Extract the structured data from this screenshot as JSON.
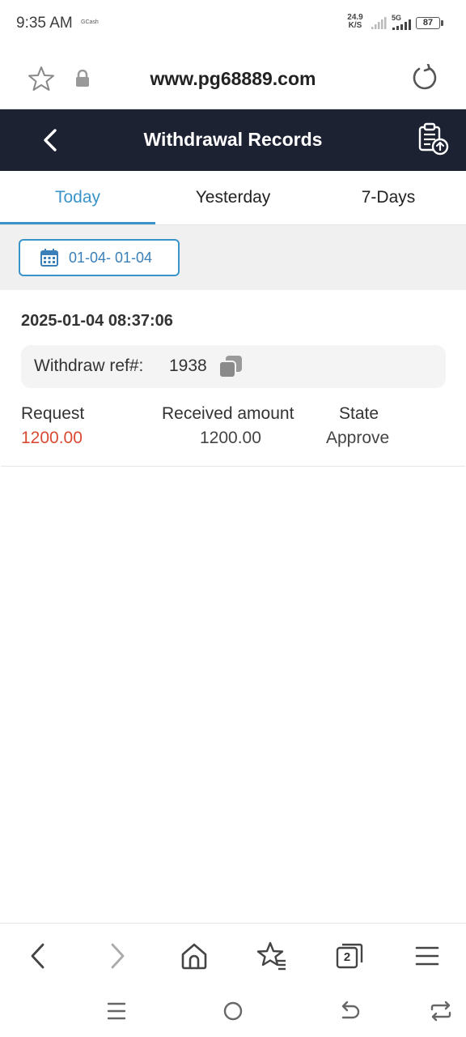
{
  "status_bar": {
    "time": "9:35 AM",
    "app_label": "GCash",
    "speed_value": "24.9",
    "speed_unit": "K/S",
    "network": "5G",
    "battery": "87"
  },
  "browser": {
    "url": "www.pg68889.com",
    "tab_count": "2"
  },
  "header": {
    "title": "Withdrawal Records"
  },
  "tabs": [
    {
      "label": "Today",
      "active": true
    },
    {
      "label": "Yesterday",
      "active": false
    },
    {
      "label": "7-Days",
      "active": false
    }
  ],
  "filter": {
    "date_range": "01-04- 01-04"
  },
  "records": [
    {
      "datetime": "2025-01-04 08:37:06",
      "ref_label": "Withdraw ref#:",
      "ref_value": "1938",
      "request_label": "Request",
      "request_value": "1200.00",
      "received_label": "Received amount",
      "received_value": "1200.00",
      "state_label": "State",
      "state_value": "Approve"
    }
  ],
  "colors": {
    "header_bg": "#1d2233",
    "accent": "#3a93c9",
    "request_amount": "#d94a33"
  }
}
